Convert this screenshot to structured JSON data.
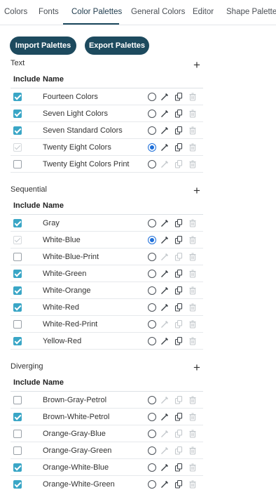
{
  "tabs": [
    {
      "label": "Colors"
    },
    {
      "label": "Fonts"
    },
    {
      "label": "Color Palettes"
    },
    {
      "label": "General Colors"
    },
    {
      "label": "Editor"
    },
    {
      "label": "Shape Palettes"
    }
  ],
  "active_tab": "Color Palettes",
  "buttons": {
    "import": "Import Palettes",
    "export": "Export Palettes"
  },
  "columns": {
    "include": "Include",
    "name": "Name"
  },
  "colors": {
    "accent": "#1d4a5e",
    "checkbox": "#3aa6c6",
    "radio": "#1e6fd9"
  },
  "sections": {
    "text": {
      "title": "Text",
      "rows": [
        {
          "name": "Fourteen Colors",
          "include": "checked",
          "default": false,
          "editable": true
        },
        {
          "name": "Seven Light Colors",
          "include": "checked",
          "default": false,
          "editable": true
        },
        {
          "name": "Seven Standard Colors",
          "include": "checked",
          "default": false,
          "editable": true
        },
        {
          "name": "Twenty Eight Colors",
          "include": "disabled",
          "default": true,
          "editable": true
        },
        {
          "name": "Twenty Eight Colors Print",
          "include": "unchecked",
          "default": false,
          "editable": false
        }
      ]
    },
    "sequential": {
      "title": "Sequential",
      "rows": [
        {
          "name": "Gray",
          "include": "checked",
          "default": false,
          "editable": true
        },
        {
          "name": "White-Blue",
          "include": "disabled",
          "default": true,
          "editable": true
        },
        {
          "name": "White-Blue-Print",
          "include": "unchecked",
          "default": false,
          "editable": false
        },
        {
          "name": "White-Green",
          "include": "checked",
          "default": false,
          "editable": true
        },
        {
          "name": "White-Orange",
          "include": "checked",
          "default": false,
          "editable": true
        },
        {
          "name": "White-Red",
          "include": "checked",
          "default": false,
          "editable": true
        },
        {
          "name": "White-Red-Print",
          "include": "unchecked",
          "default": false,
          "editable": false
        },
        {
          "name": "Yellow-Red",
          "include": "checked",
          "default": false,
          "editable": true
        }
      ]
    },
    "diverging": {
      "title": "Diverging",
      "rows": [
        {
          "name": "Brown-Gray-Petrol",
          "include": "unchecked",
          "default": false,
          "editable": false
        },
        {
          "name": "Brown-White-Petrol",
          "include": "checked",
          "default": false,
          "editable": true
        },
        {
          "name": "Orange-Gray-Blue",
          "include": "unchecked",
          "default": false,
          "editable": false
        },
        {
          "name": "Orange-Gray-Green",
          "include": "unchecked",
          "default": false,
          "editable": false
        },
        {
          "name": "Orange-White-Blue",
          "include": "checked",
          "default": false,
          "editable": true
        },
        {
          "name": "Orange-White-Green",
          "include": "checked",
          "default": false,
          "editable": true
        }
      ]
    }
  },
  "icons": {
    "add": "plus-icon",
    "edit": "pencil-icon",
    "copy": "duplicate-icon",
    "delete": "trash-icon"
  }
}
